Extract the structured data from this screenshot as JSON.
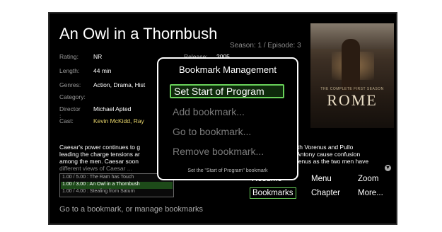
{
  "program": {
    "title": "An Owl in a Thornbush",
    "season_episode": "Season: 1 / Episode: 3"
  },
  "poster": {
    "tagline": "THE COMPLETE FIRST SEASON",
    "logo": "ROME"
  },
  "details": [
    {
      "key": "Rating:",
      "value": "NR",
      "style": "white"
    },
    {
      "key": "Length:",
      "value": "44 min",
      "style": "white"
    },
    {
      "key": "Genres:",
      "value": "Action, Drama, Hist",
      "style": "white"
    },
    {
      "key": "Category:",
      "value": "",
      "style": "white"
    },
    {
      "key": "Director :",
      "value": "Michael Apted",
      "style": "white"
    },
    {
      "key": "Cast:",
      "value": "Kevin McKidd, Ray",
      "style": "yellow"
    }
  ],
  "extra_detail": {
    "key": "Release:",
    "value": "2005"
  },
  "description": {
    "left_lines": [
      "Caesar's power continues to g",
      "leading the charge tensions ar",
      "among the men. Caesar soon",
      "different views of Caesar ..."
    ],
    "right_lines": [
      "ith Vorenus and Pullo",
      "Antony cause confusion",
      "renus as the two men have"
    ]
  },
  "bookmarks": [
    {
      "text": "1.00 / 5.00 :  The Ram has Touch",
      "selected": false
    },
    {
      "text": "1.00 / 3.00 :  An Owl in a Thornbush",
      "selected": true
    },
    {
      "text": "1.00 / 4.00 :  Stealing from Saturn",
      "selected": false
    }
  ],
  "actions": {
    "resume": "Resume",
    "menu": "Menu",
    "zoom": "Zoom",
    "bookmarks": "Bookmarks",
    "chapter": "Chapter",
    "more": "More..."
  },
  "footer_hint": "Go to a bookmark, or manage bookmarks",
  "dialog": {
    "title": "Bookmark Management",
    "items": [
      "Set Start of Program",
      "Add bookmark...",
      "Go to bookmark...",
      "Remove bookmark..."
    ],
    "selected_index": 0,
    "hint": "Set the \"Start of Program\" bookmark"
  },
  "colors": {
    "accent_green": "#69d25a",
    "cast_yellow": "#e6d36a",
    "background": "#000000"
  }
}
